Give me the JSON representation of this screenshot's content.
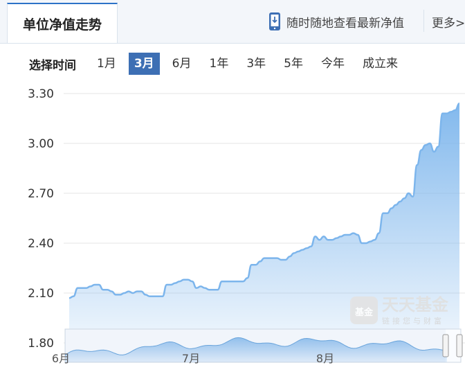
{
  "header": {
    "active_tab": "单位净值走势",
    "mobile_link": "随时随地查看最新净值",
    "more": "更多>"
  },
  "range_selector": {
    "label": "选择时间",
    "options": [
      "1月",
      "3月",
      "6月",
      "1年",
      "3年",
      "5年",
      "今年",
      "成立来"
    ],
    "selected": "3月"
  },
  "watermark": {
    "badge": "基金",
    "brand": "天天基金",
    "slogan": "链接您与财富"
  },
  "chart_data": {
    "type": "area",
    "ylim": [
      1.8,
      3.3
    ],
    "yticks": [
      3.3,
      3.0,
      2.7,
      2.4,
      2.1,
      1.8
    ],
    "navigator_ticks": [
      "6月",
      "7月",
      "8月"
    ],
    "color": "#7cb5ec",
    "series": [
      {
        "values": [
          2.07,
          2.08,
          2.13,
          2.13,
          2.13,
          2.14,
          2.15,
          2.15,
          2.12,
          2.12,
          2.11,
          2.09,
          2.09,
          2.1,
          2.11,
          2.1,
          2.11,
          2.11,
          2.09,
          2.08,
          2.08,
          2.08,
          2.08,
          2.15,
          2.15,
          2.16,
          2.17,
          2.18,
          2.18,
          2.17,
          2.13,
          2.14,
          2.13,
          2.12,
          2.12,
          2.12,
          2.17,
          2.17,
          2.17,
          2.17,
          2.17,
          2.17,
          2.19,
          2.27,
          2.27,
          2.29,
          2.31,
          2.31,
          2.31,
          2.31,
          2.3,
          2.3,
          2.32,
          2.34,
          2.35,
          2.36,
          2.37,
          2.38,
          2.44,
          2.42,
          2.44,
          2.42,
          2.42,
          2.43,
          2.44,
          2.45,
          2.45,
          2.46,
          2.45,
          2.4,
          2.4,
          2.41,
          2.42,
          2.46,
          2.58,
          2.58,
          2.61,
          2.63,
          2.65,
          2.67,
          2.7,
          2.68,
          2.87,
          2.96,
          2.99,
          3.0,
          2.95,
          2.98,
          3.18,
          3.18,
          3.19,
          3.2,
          3.24
        ]
      }
    ]
  }
}
